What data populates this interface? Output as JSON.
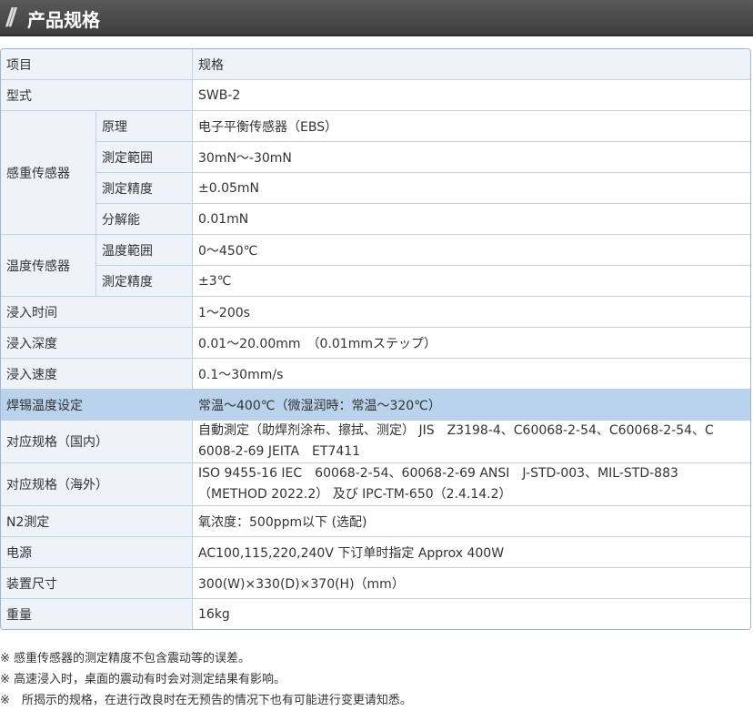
{
  "header": {
    "title": "产品规格"
  },
  "table": {
    "head_item": "项目",
    "head_spec": "规格",
    "model_label": "型式",
    "model_value": "SWB-2",
    "weight_sensor": {
      "label": "感重传感器",
      "rows": [
        {
          "label": "原理",
          "value": "电子平衡传感器（EBS）"
        },
        {
          "label": "測定範囲",
          "value": "30mN～-30mN"
        },
        {
          "label": "測定精度",
          "value": "±0.05mN"
        },
        {
          "label": "分解能",
          "value": "0.01mN"
        }
      ]
    },
    "temp_sensor": {
      "label": "温度传感器",
      "rows": [
        {
          "label": "温度範囲",
          "value": "0～450℃"
        },
        {
          "label": "測定精度",
          "value": "±3℃"
        }
      ]
    },
    "rows": [
      {
        "label": "浸入时间",
        "value": "1～200s"
      },
      {
        "label": "浸入深度",
        "value": "0.01～20.00mm　（0.01mmステップ）"
      },
      {
        "label": "浸入速度",
        "value": "0.1～30mm/s"
      },
      {
        "label": "焊锡温度设定",
        "value": "常温～400℃（微湿润時：常温～320℃）"
      },
      {
        "label": "对应规格（国内）",
        "value": "自動測定（助焊剂涂布、擦拭、测定） JIS　Z3198-4、C60068-2-54、C60068-2-54、C 6008-2-69 JEITA　ET7411"
      },
      {
        "label": "对应规格（海外）",
        "value": "ISO 9455-16 IEC　60068-2-54、60068-2-69 ANSI　J-STD-003、MIL-STD-883（METHOD 2022.2） 及び IPC-TM-650（2.4.14.2）"
      },
      {
        "label": "N2測定",
        "value": "氧浓度：500ppm以下 (选配)"
      },
      {
        "label": "电源",
        "value": "AC100,115,220,240V 下订单时指定 Approx 400W"
      },
      {
        "label": "装置尺寸",
        "value": "300(W)×330(D)×370(H)（mm）"
      },
      {
        "label": "重量",
        "value": "16kg"
      }
    ]
  },
  "notes": [
    "※ 感重传感器的测定精度不包含震动等的误差。",
    "※ 高速浸入时，桌面的震动有时会对测定结果有影响。",
    "※　所揭示的规格，在进行改良时在无预告的情况下也有可能进行变更请知悉。"
  ]
}
